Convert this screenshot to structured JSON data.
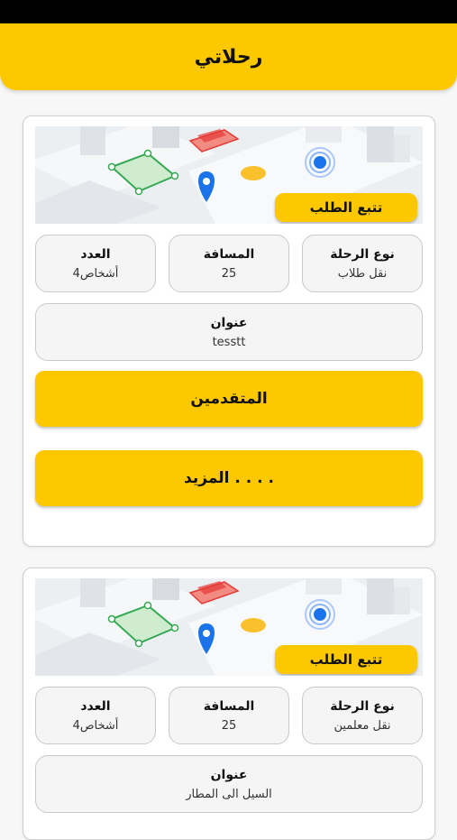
{
  "header": {
    "title": "رحلاتي"
  },
  "labels": {
    "track": "تتبع الطلب",
    "trip_type": "نوع الرحلة",
    "distance": "المسافة",
    "count": "العدد",
    "address": "عنوان"
  },
  "trips": [
    {
      "trip_type": "نقل طلاب",
      "distance": "25",
      "count": "4أشخاص",
      "address": "tesstt",
      "status_button": "المتقدمين",
      "more_button": "المزيد . . . ."
    },
    {
      "trip_type": "نقل معلمين",
      "distance": "25",
      "count": "4أشخاص",
      "address": "السيل الى المطار"
    }
  ],
  "colors": {
    "accent": "#fdc800",
    "pin": "#1a73e8",
    "zone_green": "#34a853",
    "zone_red": "#e53935"
  }
}
